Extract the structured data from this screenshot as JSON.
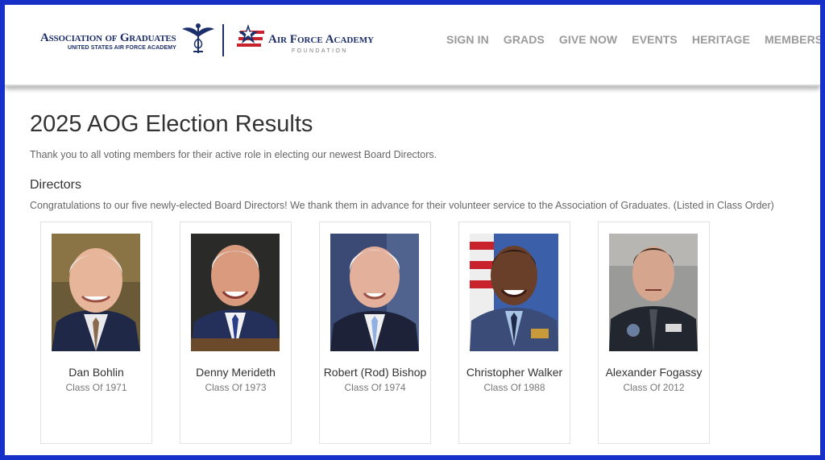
{
  "header": {
    "aog_logo": {
      "line1": "Association of Graduates",
      "line2": "UNITED STATES AIR FORCE ACADEMY"
    },
    "afa_logo": {
      "line1_a": "Air Force",
      "line1_b": "Academy",
      "line2": "FOUNDATION"
    },
    "nav": [
      "SIGN IN",
      "GRADS",
      "GIVE NOW",
      "EVENTS",
      "HERITAGE",
      "MEMBERSHIP"
    ]
  },
  "main": {
    "title": "2025 AOG Election Results",
    "intro": "Thank you to all voting members for their active role in electing our newest Board Directors.",
    "section_title": "Directors",
    "congrats": "Congratulations to our five newly-elected Board Directors! We thank them in advance for their volunteer service to the Association of Graduates. (Listed in Class Order)",
    "directors": [
      {
        "name": "Dan Bohlin",
        "class": "Class Of 1971"
      },
      {
        "name": "Denny Merideth",
        "class": "Class Of 1973"
      },
      {
        "name": "Robert (Rod) Bishop",
        "class": "Class Of 1974"
      },
      {
        "name": "Christopher Walker",
        "class": "Class Of 1988"
      },
      {
        "name": "Alexander Fogassy",
        "class": "Class Of 2012"
      }
    ]
  },
  "colors": {
    "frame": "#1730c8",
    "navy": "#1c2f6b",
    "red": "#c8232c",
    "nav_text": "#9a9a9a"
  }
}
